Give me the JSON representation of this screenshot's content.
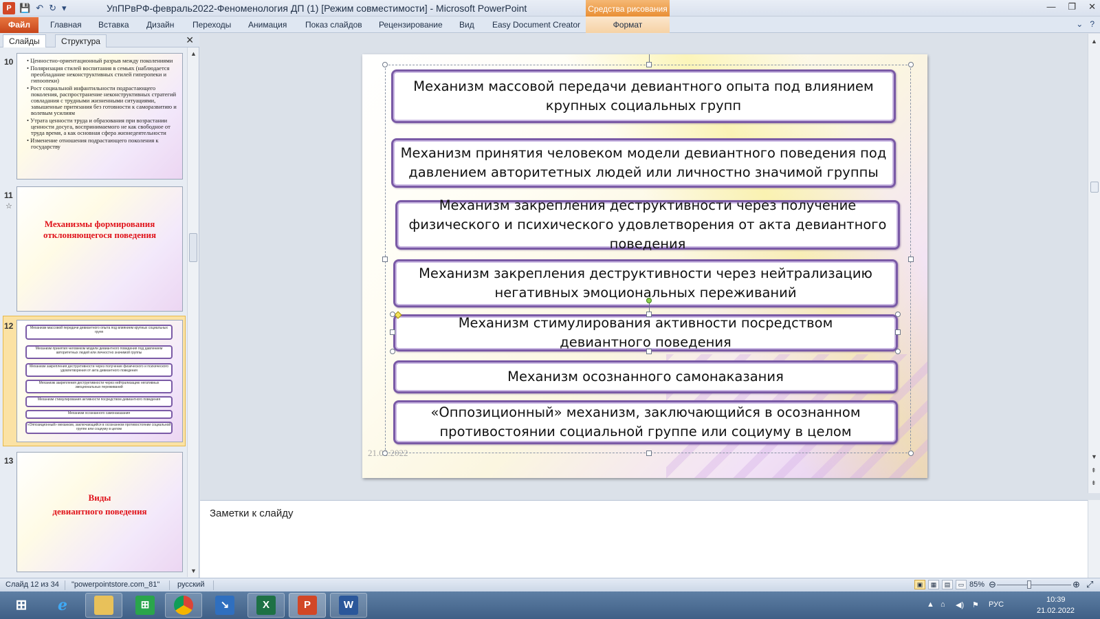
{
  "window": {
    "app_icon": "P",
    "title": "УпПРвРФ-февраль2022-Феноменология ДП (1) [Режим совместимости]  -  Microsoft PowerPoint",
    "context_group": "Средства рисования"
  },
  "ribbon": {
    "file": "Файл",
    "tabs": [
      "Главная",
      "Вставка",
      "Дизайн",
      "Переходы",
      "Анимация",
      "Показ слайдов",
      "Рецензирование",
      "Вид",
      "Easy Document Creator"
    ],
    "context_tab": "Формат"
  },
  "panel": {
    "tab_slides": "Слайды",
    "tab_outline": "Структура"
  },
  "thumbnails": {
    "s10": {
      "number": "10",
      "bullets": [
        "• Ценностно-ориентационный разрыв между поколениями",
        "• Поляризация стилей воспитания в семьях (наблюдается преобладание неконструктивных стилей гиперопеки и гипоопеки)",
        "• Рост социальной инфантильности подрастающего поколения, распространение неконструктивных стратегий совладания с трудными жизненными ситуациями, завышенные притязания без готовности к саморазвитию и волевым усилиям",
        "• Утрата ценности труда и образования при возрастании ценности досуга, воспринимаемого не как свободное от труда время, а как основная сфера жизнедеятельности",
        "• Изменение отношения подрастающего поколения к государству"
      ]
    },
    "s11": {
      "number": "11",
      "title": "Механизмы формирования отклоняющегося поведения"
    },
    "s12": {
      "number": "12",
      "boxes": [
        "Механизм массовой передачи девиантного опыта под влиянием крупных социальных групп",
        "Механизм принятия человеком модели девиантного поведения под давлением авторитетных людей или личностно значимой группы",
        "Механизм закрепления деструктивности через получение физического и психического удовлетворения от акта девиантного поведения",
        "Механизм закрепления деструктивности через нейтрализацию негативных эмоциональных переживаний",
        "Механизм стимулирования активности посредством девиантного поведения",
        "Механизм осознанного самонаказания",
        "«Оппозиционный» механизм, заключающийся в осознанном противостоянии социальной группе или социуму в целом"
      ]
    },
    "s13": {
      "number": "13",
      "title_line1": "Виды",
      "title_line2": "девиантного поведения"
    }
  },
  "slide": {
    "boxes": [
      "Механизм массовой передачи девиантного опыта под влиянием крупных социальных групп",
      "Механизм принятия человеком модели девиантного поведения под давлением авторитетных людей или личностно значимой группы",
      "Механизм закрепления деструктивности через получение  физического и психического удовлетворения  от акта девиантного поведения",
      "Механизм закрепления деструктивности через нейтрализацию негативных эмоциональных переживаний",
      "Механизм стимулирования активности посредством девиантного поведения",
      "Механизм осознанного самонаказания",
      "«Оппозиционный»  механизм, заключающийся в осознанном противостоянии  социальной группе или социуму в целом"
    ],
    "date": "21.02.2022"
  },
  "notes": {
    "placeholder": "Заметки к слайду"
  },
  "status": {
    "slide_info": "Слайд 12 из 34",
    "theme": "\"powerpointstore.com_81\"",
    "language": "русский",
    "zoom": "85%"
  },
  "taskbar": {
    "apps": [
      "windows-start",
      "internet-explorer",
      "file-explorer",
      "store",
      "chrome",
      "document-creator",
      "excel",
      "powerpoint",
      "word"
    ],
    "tray": {
      "lang": "РУС",
      "time": "10:39",
      "date": "21.02.2022"
    }
  },
  "colors": {
    "box_border": "#7a5aa6",
    "thumb_title": "#e0131b",
    "file_tab": "#c8461b",
    "context_tab": "#e98f35"
  }
}
